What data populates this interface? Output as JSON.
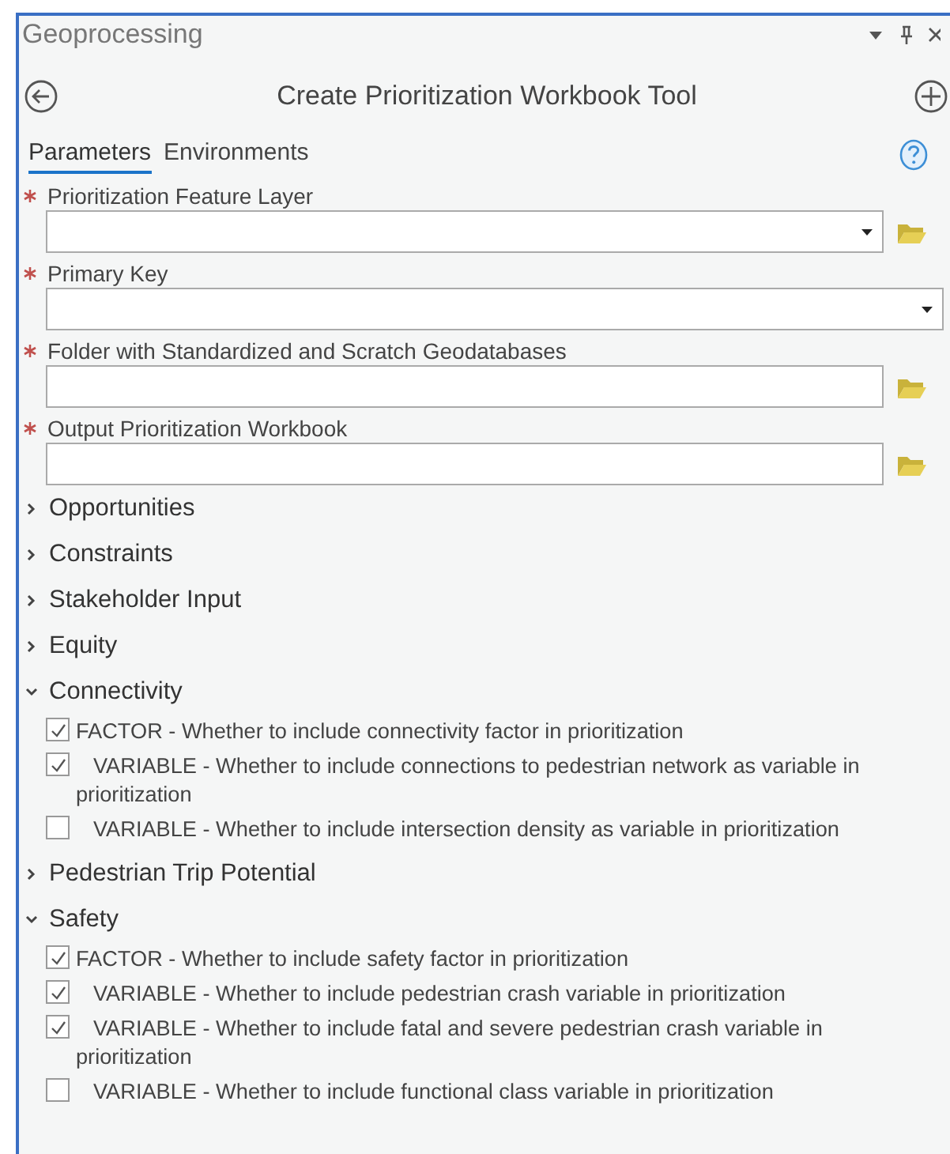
{
  "window": {
    "title": "Geoprocessing"
  },
  "tool": {
    "title": "Create Prioritization Workbook Tool"
  },
  "tabs": [
    {
      "label": "Parameters",
      "selected": true
    },
    {
      "label": "Environments",
      "selected": false
    }
  ],
  "parameters": [
    {
      "label": "Prioritization Feature Layer",
      "required": true,
      "dropdown": true,
      "browse": true
    },
    {
      "label": "Primary Key",
      "required": true,
      "dropdown": true,
      "browse": false
    },
    {
      "label": "Folder with Standardized and Scratch Geodatabases",
      "required": true,
      "dropdown": false,
      "browse": true
    },
    {
      "label": "Output Prioritization Workbook",
      "required": true,
      "dropdown": false,
      "browse": true
    }
  ],
  "groups": [
    {
      "label": "Opportunities",
      "expanded": false
    },
    {
      "label": "Constraints",
      "expanded": false
    },
    {
      "label": "Stakeholder Input",
      "expanded": false
    },
    {
      "label": "Equity",
      "expanded": false
    },
    {
      "label": "Connectivity",
      "expanded": true,
      "options": [
        {
          "kind": "factor",
          "label": "FACTOR - Whether to include connectivity factor in prioritization",
          "checked": true
        },
        {
          "kind": "variable",
          "label": "VARIABLE - Whether to include connections to pedestrian network as variable in prioritization",
          "checked": true
        },
        {
          "kind": "variable",
          "label": "VARIABLE - Whether to include intersection density as variable in prioritization",
          "checked": false
        }
      ]
    },
    {
      "label": "Pedestrian Trip Potential",
      "expanded": false
    },
    {
      "label": "Safety",
      "expanded": true,
      "options": [
        {
          "kind": "factor",
          "label": "FACTOR - Whether to include safety factor in prioritization",
          "checked": true
        },
        {
          "kind": "variable",
          "label": "VARIABLE - Whether to include pedestrian crash variable in prioritization",
          "checked": true
        },
        {
          "kind": "variable",
          "label": "VARIABLE - Whether to include fatal and severe pedestrian crash variable in prioritization",
          "checked": true
        },
        {
          "kind": "variable",
          "label": "VARIABLE - Whether to include functional class variable in prioritization",
          "checked": false
        }
      ]
    }
  ]
}
